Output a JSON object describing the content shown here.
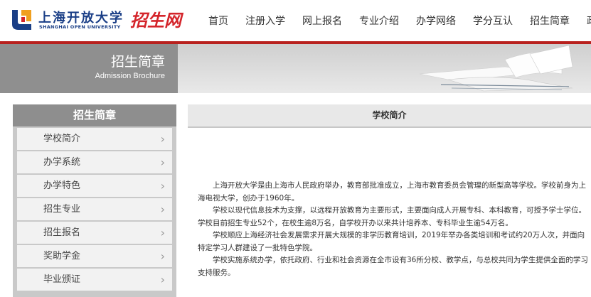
{
  "header": {
    "logo_cn": "上海开放大学",
    "logo_en": "SHANGHAI OPEN UNIVERSITY",
    "logo_badge": "招生网",
    "nav": [
      "首页",
      "注册入学",
      "网上报名",
      "专业介绍",
      "办学网络",
      "学分互认",
      "招生简章",
      "政策"
    ]
  },
  "banner": {
    "title": "招生简章",
    "subtitle": "Admission Brochure"
  },
  "sidebar": {
    "heading": "招生简章",
    "items": [
      {
        "label": "学校简介",
        "icon": "chevron-right-icon"
      },
      {
        "label": "办学系统",
        "icon": "chevron-right-icon"
      },
      {
        "label": "办学特色",
        "icon": "chevron-right-icon"
      },
      {
        "label": "招生专业",
        "icon": "chevron-right-icon"
      },
      {
        "label": "招生报名",
        "icon": "chevron-right-icon"
      },
      {
        "label": "奖助学金",
        "icon": "chevron-right-icon"
      },
      {
        "label": "毕业颁证",
        "icon": "chevron-right-icon"
      }
    ]
  },
  "content": {
    "title": "学校简介",
    "paragraphs": [
      "上海开放大学是由上海市人民政府举办，教育部批准成立，上海市教育委员会管理的新型高等学校。学校前身为上海电视大学，创办于1960年。",
      "学校以现代信息技术为支撑，以远程开放教育为主要形式，主要面向成人开展专科、本科教育，可授予学士学位。学校目前招生专业52个，在校生逾8万名，自学校开办以来共计培养本、专科毕业生逾54万名。",
      "学校顺应上海经济社会发展需求开展大规模的非学历教育培训，2019年举办各类培训和考试约20万人次，并面向特定学习人群建设了一批特色学院。",
      "学校实施系统办学，依托政府、行业和社会资源在全市设有36所分校、教学点，与总校共同为学生提供全面的学习支持服务。"
    ]
  },
  "colors": {
    "brand_blue": "#1a3e86",
    "brand_red": "#d4252b",
    "rule_red": "#b8211e",
    "sidebar_gray": "#8e8e8e"
  }
}
